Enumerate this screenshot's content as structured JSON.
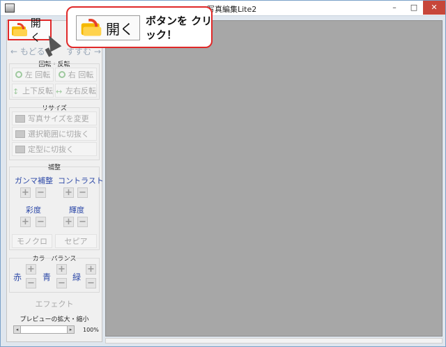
{
  "window": {
    "title": "写真編集Lite2",
    "minimize": "–",
    "maximize": "□",
    "close": "✕"
  },
  "toolbar": {
    "open_label": "開く"
  },
  "nav": {
    "back_label": "← もどる",
    "forward_label": "すすむ →"
  },
  "rotate_section": {
    "title": "回転・反転",
    "left_rotate": "左 回転",
    "right_rotate": "右 回転",
    "flip_vertical": "上下反転",
    "flip_horizontal": "左右反転"
  },
  "resize_section": {
    "title": "リサイズ",
    "change_size": "写真サイズを変更",
    "crop_selection": "選択範囲に切抜く",
    "crop_fixed": "定型に切抜く"
  },
  "adjust_section": {
    "title": "補整",
    "gamma": "ガンマ補整",
    "contrast": "コントラスト",
    "saturation": "彩度",
    "brightness": "輝度",
    "mono": "モノクロ",
    "sepia": "セピア"
  },
  "balance_section": {
    "title": "カラーバランス",
    "red": "赤",
    "blue": "青",
    "green": "緑"
  },
  "effect": {
    "label": "エフェクト"
  },
  "preview": {
    "title": "プレビューの拡大・縮小",
    "zoom_value": "100%"
  },
  "callout": {
    "text": "ボタンを クリック！",
    "button_label": "開く"
  },
  "icons": {
    "plus": "+",
    "minus": "−",
    "left": "◂",
    "right": "▸"
  }
}
